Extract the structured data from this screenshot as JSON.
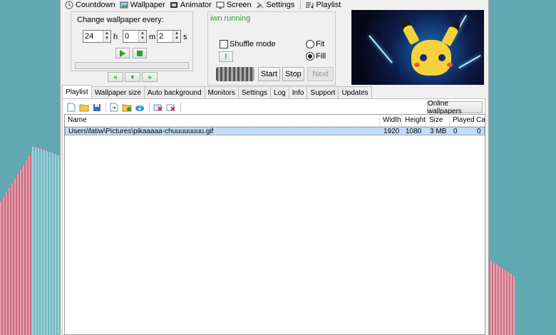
{
  "menu": {
    "items": [
      {
        "label": "Countdown",
        "icon": "clock-icon"
      },
      {
        "label": "Wallpaper",
        "icon": "wallpaper-icon"
      },
      {
        "label": "Animator",
        "icon": "film-icon"
      },
      {
        "label": "Screen",
        "icon": "monitor-icon"
      },
      {
        "label": "Settings",
        "icon": "wrench-icon"
      },
      {
        "label": "Playlist",
        "icon": "playlist-icon"
      }
    ]
  },
  "timer": {
    "title": "Change wallpaper every:",
    "hours": "24",
    "hours_unit": "h",
    "minutes": "0",
    "minutes_unit": "m",
    "seconds": "2",
    "seconds_unit": "s"
  },
  "status": {
    "text": "iwn running"
  },
  "controls": {
    "shuffle_label": "Shuffle mode",
    "shuffle_checked": false,
    "fit_label": "Fit",
    "fill_label": "Fill",
    "selected_mode": "Fill",
    "start_label": "Start",
    "stop_label": "Stop",
    "next_label": "Next",
    "warning_glyph": "!"
  },
  "tabs": [
    "Playlist",
    "Wallpaper size",
    "Auto background",
    "Monitors",
    "Settings",
    "Log",
    "Info",
    "Support",
    "Updates"
  ],
  "active_tab": "Playlist",
  "toolbar": {
    "online_label": "Online wallpapers"
  },
  "playlist": {
    "columns": [
      "Name",
      "Width",
      "Height",
      "Size",
      "Played",
      "Ca"
    ],
    "rows": [
      {
        "name": "Users\\fatiw\\Pictures\\pikaaaaa-chuuuuuuuu.gif",
        "width": "1920",
        "height": "1080",
        "size": "3 MB",
        "played": "0",
        "ca": "0"
      }
    ]
  },
  "colors": {
    "desktop": "#62a8b2",
    "window_bg": "#f0f0f0",
    "status_green": "#2c9f2c",
    "row_selected": "#c4ddf5"
  }
}
